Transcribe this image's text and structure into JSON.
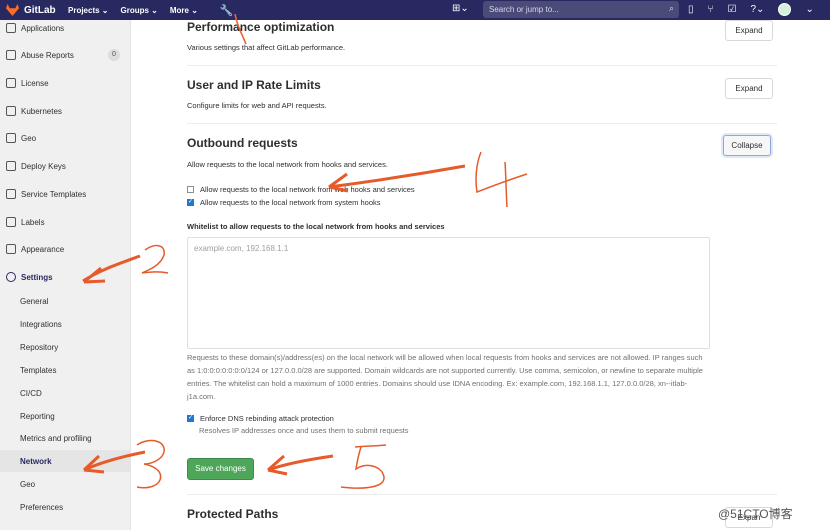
{
  "header": {
    "brand": "GitLab",
    "nav": [
      "Projects ⌄",
      "Groups ⌄",
      "More ⌄"
    ],
    "search_placeholder": "Search or jump to..."
  },
  "sidebar": {
    "items": [
      {
        "label": "Applications",
        "icon": "app-icon"
      },
      {
        "label": "Abuse Reports",
        "badge": "0",
        "icon": "report-icon"
      },
      {
        "label": "License",
        "icon": "license-icon"
      },
      {
        "label": "Kubernetes",
        "icon": "kubernetes-icon"
      },
      {
        "label": "Geo",
        "icon": "geo-icon"
      },
      {
        "label": "Deploy Keys",
        "icon": "key-icon"
      },
      {
        "label": "Service Templates",
        "icon": "template-icon"
      },
      {
        "label": "Labels",
        "icon": "label-icon"
      },
      {
        "label": "Appearance",
        "icon": "appearance-icon"
      },
      {
        "label": "Settings",
        "icon": "settings-icon"
      }
    ],
    "settings_subitems": [
      "General",
      "Integrations",
      "Repository",
      "Templates",
      "CI/CD",
      "Reporting",
      "Metrics and profiling",
      "Network",
      "Geo",
      "Preferences"
    ]
  },
  "main": {
    "performance_title": "Performance optimization",
    "performance_desc": "Various settings that affect GitLab performance.",
    "rate_title": "User and IP Rate Limits",
    "rate_desc": "Configure limits for web and API requests.",
    "outbound_title": "Outbound requests",
    "outbound_desc": "Allow requests to the local network from hooks and services.",
    "web_hooks_label": "Allow requests to the local network from web hooks and services",
    "system_hooks_label": "Allow requests to the local network from system hooks",
    "whitelist_label": "Whitelist to allow requests to the local network from hooks and services",
    "whitelist_placeholder": "example.com, 192.168.1.1",
    "help_text": "Requests to these domain(s)/address(es) on the local network will be allowed when local requests from hooks and services are not allowed. IP ranges such as 1:0:0:0:0:0:0:0/124 or 127.0.0.0/28 are supported. Domain wildcards are not supported currently. Use comma, semicolon, or newline to separate multiple entries. The whitelist can hold a maximum of 1000 entries. Domains should use IDNA encoding. Ex: example.com, 192.168.1.1, 127.0.0.0/28, xn--itlab-j1a.com.",
    "dns_label": "Enforce DNS rebinding attack protection",
    "dns_help": "Resolves IP addresses once and uses them to submit requests",
    "save_label": "Save changes",
    "protected_title": "Protected Paths",
    "expand_label": "Expand",
    "collapse_label": "Collapse",
    "protected_button_partial": "Expan"
  },
  "watermark": "@51CTO博客"
}
